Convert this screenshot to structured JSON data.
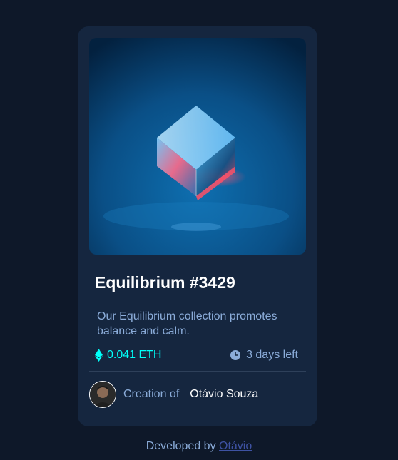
{
  "card": {
    "image_alt": "Equilibrium cube artwork",
    "title": "Equilibrium #3429",
    "description": "Our Equilibrium collection promotes balance and calm.",
    "price": "0.041 ETH",
    "time_left": "3 days left",
    "creator_prefix": "Creation of",
    "creator_name": "Otávio Souza"
  },
  "footer": {
    "prefix": "Developed by",
    "link_text": "Otávio"
  },
  "colors": {
    "page_bg": "#0e1829",
    "card_bg": "#15263f",
    "accent_cyan": "#00fff8",
    "soft_blue": "#8bacd9",
    "white": "#ffffff"
  },
  "icons": [
    "ethereum-icon",
    "clock-icon"
  ]
}
